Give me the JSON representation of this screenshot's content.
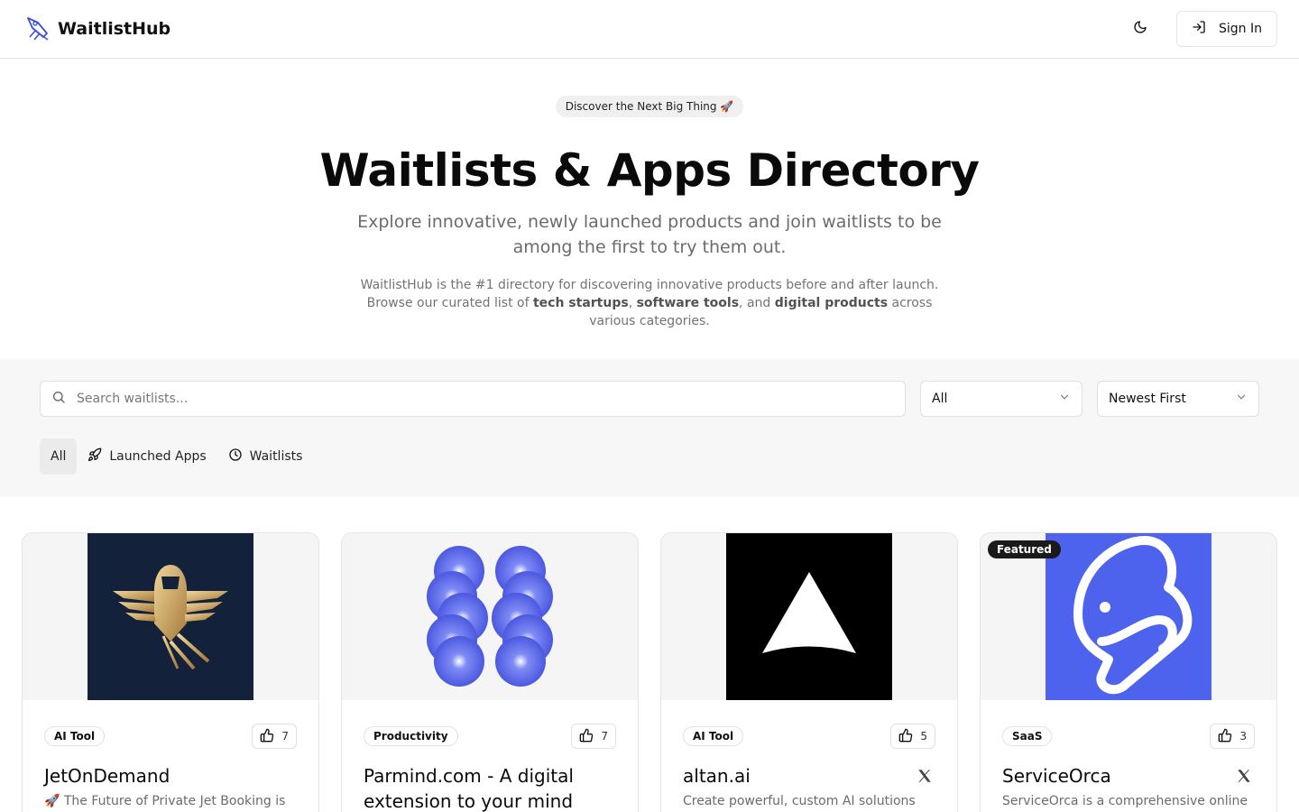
{
  "header": {
    "brand": "WaitlistHub",
    "sign_in_label": "Sign In"
  },
  "hero": {
    "badge": "Discover the Next Big Thing 🚀",
    "title": "Waitlists & Apps Directory",
    "subtitle": "Explore innovative, newly launched products and join waitlists to be among the first to try them out.",
    "desc_part1": "WaitlistHub is the #1 directory for discovering innovative products before and after launch. Browse our curated list of ",
    "desc_b1": "tech startups",
    "desc_sep1": ", ",
    "desc_b2": "software tools",
    "desc_sep2": ", and ",
    "desc_b3": "digital products",
    "desc_part2": " across various categories."
  },
  "filters": {
    "search_placeholder": "Search waitlists...",
    "category_value": "All",
    "sort_value": "Newest First",
    "tabs": [
      {
        "label": "All"
      },
      {
        "label": "Launched Apps"
      },
      {
        "label": "Waitlists"
      }
    ]
  },
  "cards": [
    {
      "category": "AI Tool",
      "votes": "7",
      "title": "JetOnDemand",
      "desc": "🚀 The Future of Private Jet Booking is",
      "featured": ""
    },
    {
      "category": "Productivity",
      "votes": "7",
      "title": "Parmind.com - A digital extension to your mind",
      "desc": "",
      "featured": ""
    },
    {
      "category": "AI Tool",
      "votes": "5",
      "title": "altan.ai",
      "desc": "Create powerful, custom AI solutions",
      "featured": ""
    },
    {
      "category": "SaaS",
      "votes": "3",
      "title": "ServiceOrca",
      "desc": "ServiceOrca is a comprehensive online",
      "featured": "Featured"
    }
  ],
  "colors": {
    "logo_accent": "#3b4fd8",
    "parmind_blue": "#4250e0",
    "orca_blue": "#4d63ee",
    "jet_navy": "#14213a",
    "jet_gold": "#c9a25e"
  }
}
